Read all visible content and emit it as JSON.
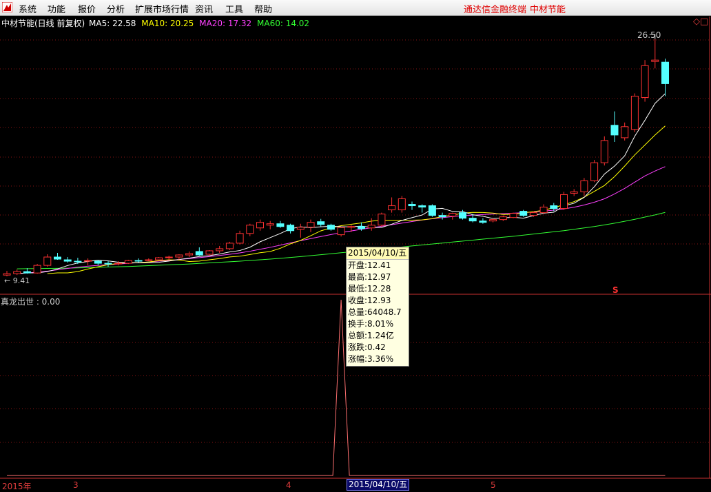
{
  "menu": [
    "系统",
    "功能",
    "报价",
    "分析",
    "扩展市场行情",
    "资讯",
    "工具",
    "帮助"
  ],
  "menu_right": [
    "通达信金融终端",
    "中材节能"
  ],
  "stock_title": "中材节能(日线 前复权)",
  "ma": [
    {
      "label": "MA5: 22.58",
      "color": "#ffffff"
    },
    {
      "label": "MA10: 20.25",
      "color": "#ffff00"
    },
    {
      "label": "MA20: 17.32",
      "color": "#ff40ff"
    },
    {
      "label": "MA60: 14.02",
      "color": "#33ff33"
    }
  ],
  "indicator_label": "真龙出世 : 0.00",
  "high_marker": "26.50",
  "low_marker": "9.41",
  "s_marker": "S",
  "tooltip": {
    "date": "2015/04/10/五",
    "rows": [
      "开盘:12.41",
      "最高:12.97",
      "最低:12.28",
      "收盘:12.93",
      "总量:64048.7",
      "换手:8.01%",
      "总额:1.24亿",
      "涨跌:0.42",
      "涨幅:3.36%"
    ]
  },
  "date_axis": {
    "labels": [
      "2015年",
      "3",
      "4",
      "5"
    ],
    "cursor": "2015/04/10/五"
  },
  "colors": {
    "up": "#ff3232",
    "down": "#54ffff",
    "grid": "#8a1414",
    "axis": "#c83030",
    "ma5": "#ffffff",
    "ma10": "#ffff00",
    "ma20": "#ff40ff",
    "ma60": "#33ff33"
  },
  "chart_data": {
    "type": "candlestick",
    "ylim": [
      9.41,
      26.5
    ],
    "candles": [
      {
        "o": 9.5,
        "h": 9.8,
        "l": 9.41,
        "c": 9.6
      },
      {
        "o": 9.6,
        "h": 9.9,
        "l": 9.5,
        "c": 9.75
      },
      {
        "o": 9.75,
        "h": 10.0,
        "l": 9.6,
        "c": 9.65
      },
      {
        "o": 9.65,
        "h": 10.3,
        "l": 9.6,
        "c": 10.2
      },
      {
        "o": 10.2,
        "h": 11.0,
        "l": 10.1,
        "c": 10.8
      },
      {
        "o": 10.8,
        "h": 11.1,
        "l": 10.6,
        "c": 10.65
      },
      {
        "o": 10.6,
        "h": 10.8,
        "l": 10.4,
        "c": 10.5
      },
      {
        "o": 10.5,
        "h": 10.75,
        "l": 10.3,
        "c": 10.45
      },
      {
        "o": 10.5,
        "h": 10.7,
        "l": 10.2,
        "c": 10.55
      },
      {
        "o": 10.5,
        "h": 10.6,
        "l": 10.2,
        "c": 10.35
      },
      {
        "o": 10.35,
        "h": 10.5,
        "l": 10.1,
        "c": 10.3
      },
      {
        "o": 10.3,
        "h": 10.5,
        "l": 10.2,
        "c": 10.35
      },
      {
        "o": 10.35,
        "h": 10.6,
        "l": 10.3,
        "c": 10.55
      },
      {
        "o": 10.55,
        "h": 10.7,
        "l": 10.4,
        "c": 10.5
      },
      {
        "o": 10.55,
        "h": 10.7,
        "l": 10.5,
        "c": 10.6
      },
      {
        "o": 10.6,
        "h": 10.8,
        "l": 10.55,
        "c": 10.75
      },
      {
        "o": 10.75,
        "h": 10.9,
        "l": 10.6,
        "c": 10.8
      },
      {
        "o": 10.8,
        "h": 11.0,
        "l": 10.6,
        "c": 10.95
      },
      {
        "o": 10.95,
        "h": 11.2,
        "l": 10.8,
        "c": 11.05
      },
      {
        "o": 11.2,
        "h": 11.5,
        "l": 10.9,
        "c": 10.95
      },
      {
        "o": 11.0,
        "h": 11.3,
        "l": 10.9,
        "c": 11.25
      },
      {
        "o": 11.25,
        "h": 11.6,
        "l": 11.1,
        "c": 11.4
      },
      {
        "o": 11.4,
        "h": 11.9,
        "l": 11.3,
        "c": 11.8
      },
      {
        "o": 11.8,
        "h": 12.7,
        "l": 11.7,
        "c": 12.5
      },
      {
        "o": 12.5,
        "h": 13.2,
        "l": 12.3,
        "c": 13.1
      },
      {
        "o": 12.9,
        "h": 13.5,
        "l": 12.7,
        "c": 13.3
      },
      {
        "o": 13.1,
        "h": 13.4,
        "l": 12.8,
        "c": 13.2
      },
      {
        "o": 13.2,
        "h": 13.4,
        "l": 12.9,
        "c": 13.0
      },
      {
        "o": 13.1,
        "h": 13.2,
        "l": 12.5,
        "c": 12.7
      },
      {
        "o": 12.8,
        "h": 13.2,
        "l": 12.2,
        "c": 12.95
      },
      {
        "o": 12.95,
        "h": 13.5,
        "l": 12.6,
        "c": 13.3
      },
      {
        "o": 13.35,
        "h": 13.55,
        "l": 13.0,
        "c": 13.15
      },
      {
        "o": 13.1,
        "h": 13.2,
        "l": 12.7,
        "c": 12.8
      },
      {
        "o": 12.41,
        "h": 12.97,
        "l": 12.28,
        "c": 12.93
      },
      {
        "o": 12.95,
        "h": 13.1,
        "l": 12.6,
        "c": 13.0
      },
      {
        "o": 13.0,
        "h": 13.3,
        "l": 12.7,
        "c": 12.85
      },
      {
        "o": 12.9,
        "h": 13.6,
        "l": 12.7,
        "c": 13.1
      },
      {
        "o": 13.1,
        "h": 14.0,
        "l": 13.0,
        "c": 13.9
      },
      {
        "o": 14.2,
        "h": 15.1,
        "l": 14.0,
        "c": 14.5
      },
      {
        "o": 14.2,
        "h": 15.2,
        "l": 14.0,
        "c": 15.0
      },
      {
        "o": 14.6,
        "h": 14.8,
        "l": 14.2,
        "c": 14.5
      },
      {
        "o": 14.5,
        "h": 14.6,
        "l": 14.0,
        "c": 14.4
      },
      {
        "o": 14.5,
        "h": 14.6,
        "l": 13.7,
        "c": 13.8
      },
      {
        "o": 13.8,
        "h": 14.0,
        "l": 13.5,
        "c": 13.7
      },
      {
        "o": 13.75,
        "h": 14.0,
        "l": 13.5,
        "c": 13.95
      },
      {
        "o": 14.0,
        "h": 14.2,
        "l": 13.5,
        "c": 13.6
      },
      {
        "o": 13.6,
        "h": 13.9,
        "l": 13.3,
        "c": 13.4
      },
      {
        "o": 13.4,
        "h": 13.6,
        "l": 13.2,
        "c": 13.3
      },
      {
        "o": 13.4,
        "h": 13.6,
        "l": 13.3,
        "c": 13.5
      },
      {
        "o": 13.5,
        "h": 13.8,
        "l": 13.4,
        "c": 13.7
      },
      {
        "o": 13.65,
        "h": 14.0,
        "l": 13.6,
        "c": 13.95
      },
      {
        "o": 14.1,
        "h": 14.2,
        "l": 13.7,
        "c": 13.8
      },
      {
        "o": 13.8,
        "h": 14.1,
        "l": 13.7,
        "c": 14.0
      },
      {
        "o": 14.0,
        "h": 14.6,
        "l": 13.9,
        "c": 14.4
      },
      {
        "o": 14.5,
        "h": 14.7,
        "l": 14.1,
        "c": 14.3
      },
      {
        "o": 14.3,
        "h": 15.5,
        "l": 14.2,
        "c": 15.3
      },
      {
        "o": 15.4,
        "h": 15.7,
        "l": 15.2,
        "c": 15.5
      },
      {
        "o": 15.5,
        "h": 16.5,
        "l": 15.2,
        "c": 16.3
      },
      {
        "o": 16.3,
        "h": 17.8,
        "l": 16.2,
        "c": 17.6
      },
      {
        "o": 17.6,
        "h": 19.5,
        "l": 17.4,
        "c": 19.2
      },
      {
        "o": 20.3,
        "h": 21.3,
        "l": 19.1,
        "c": 19.6
      },
      {
        "o": 19.4,
        "h": 20.5,
        "l": 19.2,
        "c": 20.2
      },
      {
        "o": 20.0,
        "h": 22.6,
        "l": 19.8,
        "c": 22.4
      },
      {
        "o": 22.3,
        "h": 25.0,
        "l": 22.0,
        "c": 24.6
      },
      {
        "o": 24.9,
        "h": 26.5,
        "l": 24.4,
        "c": 25.0
      },
      {
        "o": 24.85,
        "h": 25.1,
        "l": 22.4,
        "c": 23.3
      }
    ],
    "ma5": [
      9.6,
      9.66,
      9.66,
      9.75,
      9.94,
      10.19,
      10.37,
      10.48,
      10.58,
      10.52,
      10.43,
      10.38,
      10.38,
      10.39,
      10.42,
      10.51,
      10.62,
      10.72,
      10.84,
      10.9,
      11.02,
      11.17,
      11.27,
      11.51,
      11.9,
      12.2,
      12.5,
      12.84,
      12.98,
      12.92,
      12.98,
      13.02,
      12.99,
      12.98,
      13.03,
      12.94,
      12.93,
      13.17,
      13.44,
      13.64,
      13.83,
      14.26,
      14.31,
      14.09,
      14.08,
      13.85,
      13.74,
      13.58,
      13.62,
      13.67,
      13.6,
      13.79,
      13.96,
      14.03,
      14.49,
      14.68,
      15.1,
      15.87,
      16.78,
      17.36,
      18.1,
      19.52,
      20.66,
      21.88,
      22.58
    ],
    "ma10": [
      9.6,
      9.66,
      9.66,
      9.75,
      9.94,
      10.1,
      10.25,
      10.34,
      10.4,
      10.39,
      10.45,
      10.54,
      10.6,
      10.58,
      10.48,
      10.51,
      10.6,
      10.69,
      10.81,
      10.86,
      10.98,
      11.11,
      11.2,
      11.43,
      11.75,
      12.0,
      12.34,
      12.69,
      12.9,
      13.06,
      13.16,
      13.26,
      13.39,
      13.45,
      13.45,
      13.45,
      13.46,
      13.48,
      13.57,
      13.72,
      13.82,
      13.97,
      14.02,
      14.01,
      13.97,
      13.87,
      13.88,
      13.99,
      14.07,
      14.18,
      14.36,
      14.57,
      14.79,
      15.12,
      15.53,
      15.96,
      16.6,
      17.36,
      18.17,
      18.88,
      19.6,
      20.25
    ],
    "ma20": [
      9.6,
      9.66,
      9.7,
      9.78,
      9.88,
      9.98,
      10.07,
      10.14,
      10.2,
      10.25,
      10.3,
      10.35,
      10.4,
      10.45,
      10.5,
      10.56,
      10.62,
      10.69,
      10.76,
      10.83,
      10.91,
      11.0,
      11.1,
      11.22,
      11.36,
      11.5,
      11.66,
      11.82,
      11.98,
      12.13,
      12.28,
      12.42,
      12.56,
      12.68,
      12.8,
      12.91,
      13.02,
      13.13,
      13.25,
      13.36,
      13.47,
      13.56,
      13.64,
      13.72,
      13.78,
      13.82,
      13.86,
      13.9,
      13.93,
      13.96,
      14.0,
      14.05,
      14.11,
      14.18,
      14.27,
      14.39,
      14.55,
      14.75,
      15.0,
      15.35,
      15.75,
      16.2,
      16.65,
      17.0,
      17.32
    ],
    "ma60": [
      9.95,
      9.96,
      9.97,
      9.98,
      9.99,
      10.0,
      10.02,
      10.04,
      10.06,
      10.08,
      10.1,
      10.12,
      10.15,
      10.18,
      10.21,
      10.24,
      10.27,
      10.3,
      10.34,
      10.38,
      10.42,
      10.46,
      10.5,
      10.55,
      10.6,
      10.65,
      10.71,
      10.77,
      10.83,
      10.9,
      10.97,
      11.04,
      11.11,
      11.18,
      11.25,
      11.32,
      11.39,
      11.46,
      11.53,
      11.6,
      11.67,
      11.74,
      11.81,
      11.88,
      11.95,
      12.02,
      12.09,
      12.16,
      12.23,
      12.3,
      12.38,
      12.46,
      12.54,
      12.62,
      12.7,
      12.8,
      12.9,
      13.0,
      13.12,
      13.24,
      13.38,
      13.52,
      13.68,
      13.84,
      14.02
    ],
    "indicator": {
      "label": "真龙出世",
      "value": 0.0,
      "spike_index": 33
    }
  }
}
